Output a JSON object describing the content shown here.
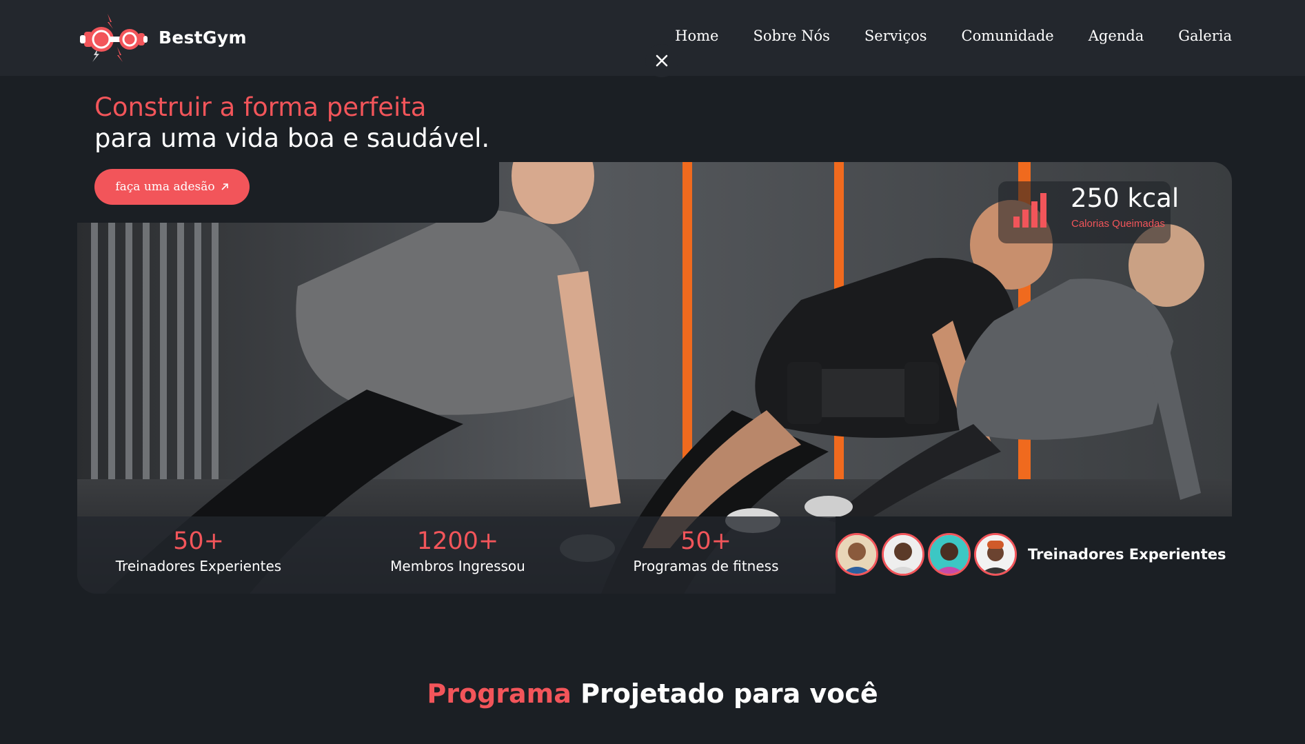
{
  "brand": {
    "name": "BestGym",
    "logo_icon": "dumbbell-icon"
  },
  "nav": {
    "items": [
      "Home",
      "Sobre Nós",
      "Serviços",
      "Comunidade",
      "Agenda",
      "Galeria"
    ],
    "close_icon": "close-icon"
  },
  "hero": {
    "title_line1": "Construir a forma perfeita",
    "title_line2": "para uma vida boa e saudável.",
    "cta_label": "faça uma adesão",
    "cta_icon": "arrow-up-right-icon",
    "calories": {
      "value": "250 kcal",
      "label": "Calorias Queimadas",
      "icon": "bar-chart-icon"
    }
  },
  "stats": [
    {
      "number": "50+",
      "label": "Treinadores Experientes"
    },
    {
      "number": "1200+",
      "label": "Membros Ingressou"
    },
    {
      "number": "50+",
      "label": "Programas de fitness"
    }
  ],
  "trainers": {
    "label": "Treinadores Experientes"
  },
  "program_section": {
    "title_accent": "Programa",
    "title_rest": "Projetado para você"
  },
  "colors": {
    "accent": "#f2555a",
    "background": "#1b1f24",
    "navbar": "#23272d"
  }
}
